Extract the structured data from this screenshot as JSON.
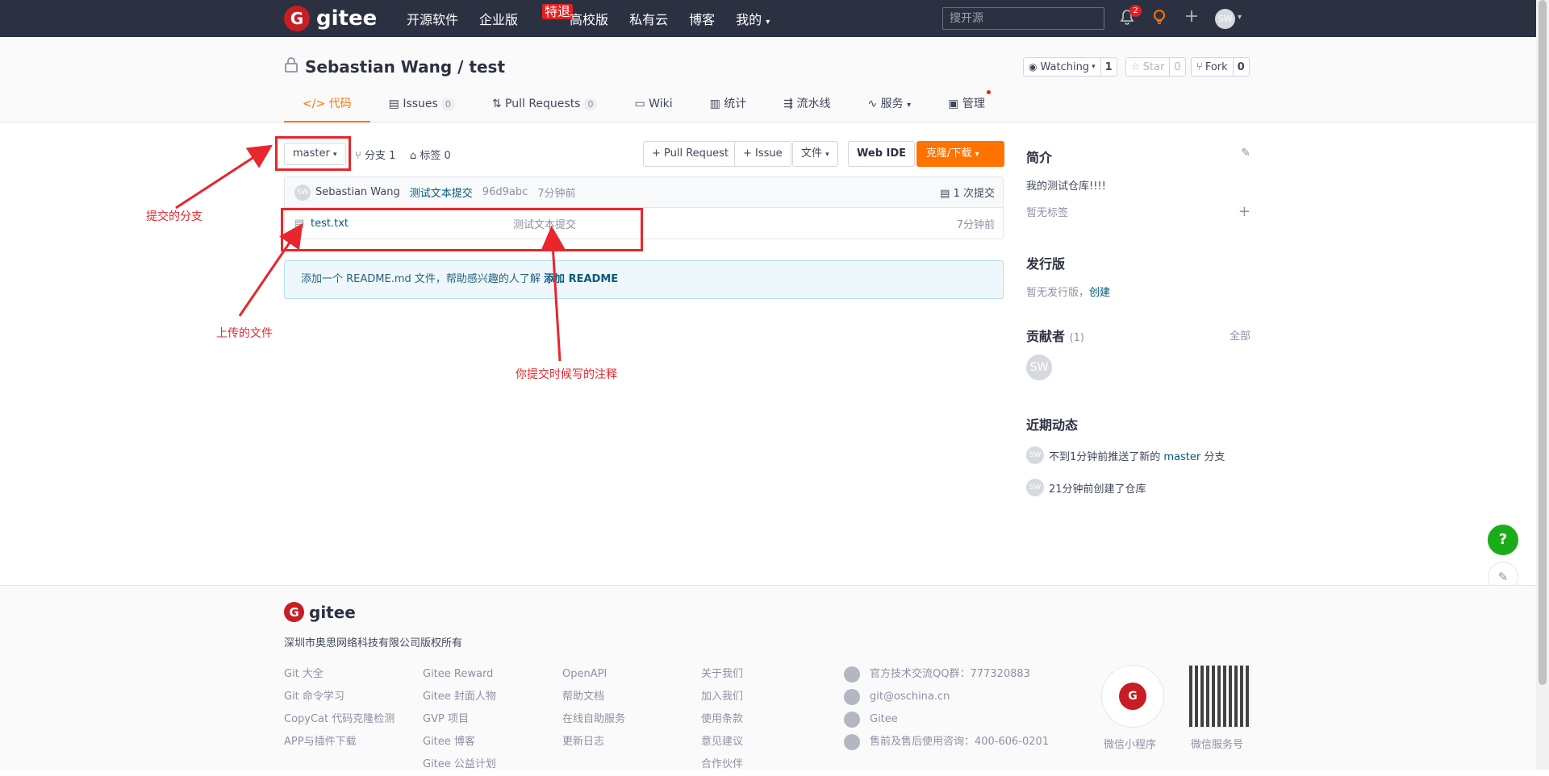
{
  "topnav": {
    "logo_mark": "G",
    "logo_text": "gitee",
    "items": [
      "开源软件",
      "企业版",
      "高校版",
      "私有云",
      "博客",
      "我的"
    ],
    "hot_badge": "特退",
    "search_placeholder": "搜开源",
    "bell_count": "2",
    "avatar": "SW"
  },
  "repo": {
    "owner_name": "Sebastian Wang / test",
    "watch_label": "Watching",
    "watch_count": "1",
    "star_label": "Star",
    "star_count": "0",
    "fork_label": "Fork",
    "fork_count": "0"
  },
  "tabs": [
    {
      "label": "代码",
      "count": ""
    },
    {
      "label": "Issues",
      "count": "0"
    },
    {
      "label": "Pull Requests",
      "count": "0"
    },
    {
      "label": "Wiki",
      "count": ""
    },
    {
      "label": "统计",
      "count": ""
    },
    {
      "label": "流水线",
      "count": ""
    },
    {
      "label": "服务",
      "count": ""
    },
    {
      "label": "管理",
      "count": ""
    }
  ],
  "toolbar": {
    "branch": "master",
    "branches": "分支 1",
    "tags": "标签 0",
    "pull_request": "+ Pull Request",
    "issue": "+ Issue",
    "file": "文件",
    "web_ide": "Web IDE",
    "clone": "克隆/下载"
  },
  "commit": {
    "avatar": "SW",
    "author": "Sebastian Wang",
    "message": "测试文本提交",
    "hash": "96d9abc",
    "time": "7分钟前",
    "count": "1 次提交"
  },
  "files": [
    {
      "name": "test.txt",
      "message": "测试文本提交",
      "time": "7分钟前"
    }
  ],
  "readme_notice": {
    "text": "添加一个 README.md 文件，帮助感兴趣的人了解",
    "link": "添加 README"
  },
  "annotations": {
    "branch": "提交的分支",
    "file": "上传的文件",
    "comment": "你提交时候写的注释"
  },
  "sidebar": {
    "intro_title": "简介",
    "intro_text": "我的测试仓库!!!!",
    "no_tags": "暂无标签",
    "release_title": "发行版",
    "no_release": "暂无发行版，",
    "create": "创建",
    "contributors_title": "贡献者",
    "contributors_count": "(1)",
    "all": "全部",
    "contributor_avatar": "SW",
    "activity_title": "近期动态",
    "activities": [
      {
        "avatar": "SW",
        "text_pre": "不到1分钟前推送了新的 ",
        "branch": "master",
        "text_post": " 分支"
      },
      {
        "avatar": "SW",
        "text_pre": "21分钟前创建了仓库",
        "branch": "",
        "text_post": ""
      }
    ]
  },
  "footer": {
    "logo_text": "gitee",
    "copyright": "深圳市奥思网络科技有限公司版权所有",
    "col1": [
      "Git 大全",
      "Git 命令学习",
      "CopyCat 代码克隆检测",
      "APP与插件下载"
    ],
    "col2": [
      "Gitee Reward",
      "Gitee 封面人物",
      "GVP 项目",
      "Gitee 博客",
      "Gitee 公益计划"
    ],
    "col3": [
      "OpenAPI",
      "帮助文档",
      "在线自助服务",
      "更新日志"
    ],
    "col4": [
      "关于我们",
      "加入我们",
      "使用条款",
      "意见建议",
      "合作伙伴"
    ],
    "contacts": [
      "官方技术交流QQ群：777320883",
      "git@oschina.cn",
      "Gitee",
      "售前及售后使用咨询：400-606-0201"
    ],
    "qr1_label": "微信小程序",
    "qr2_label": "微信服务号"
  },
  "colors": {
    "accent": "#fe7300",
    "brand": "#c71d23",
    "annotation": "#e8262b"
  }
}
